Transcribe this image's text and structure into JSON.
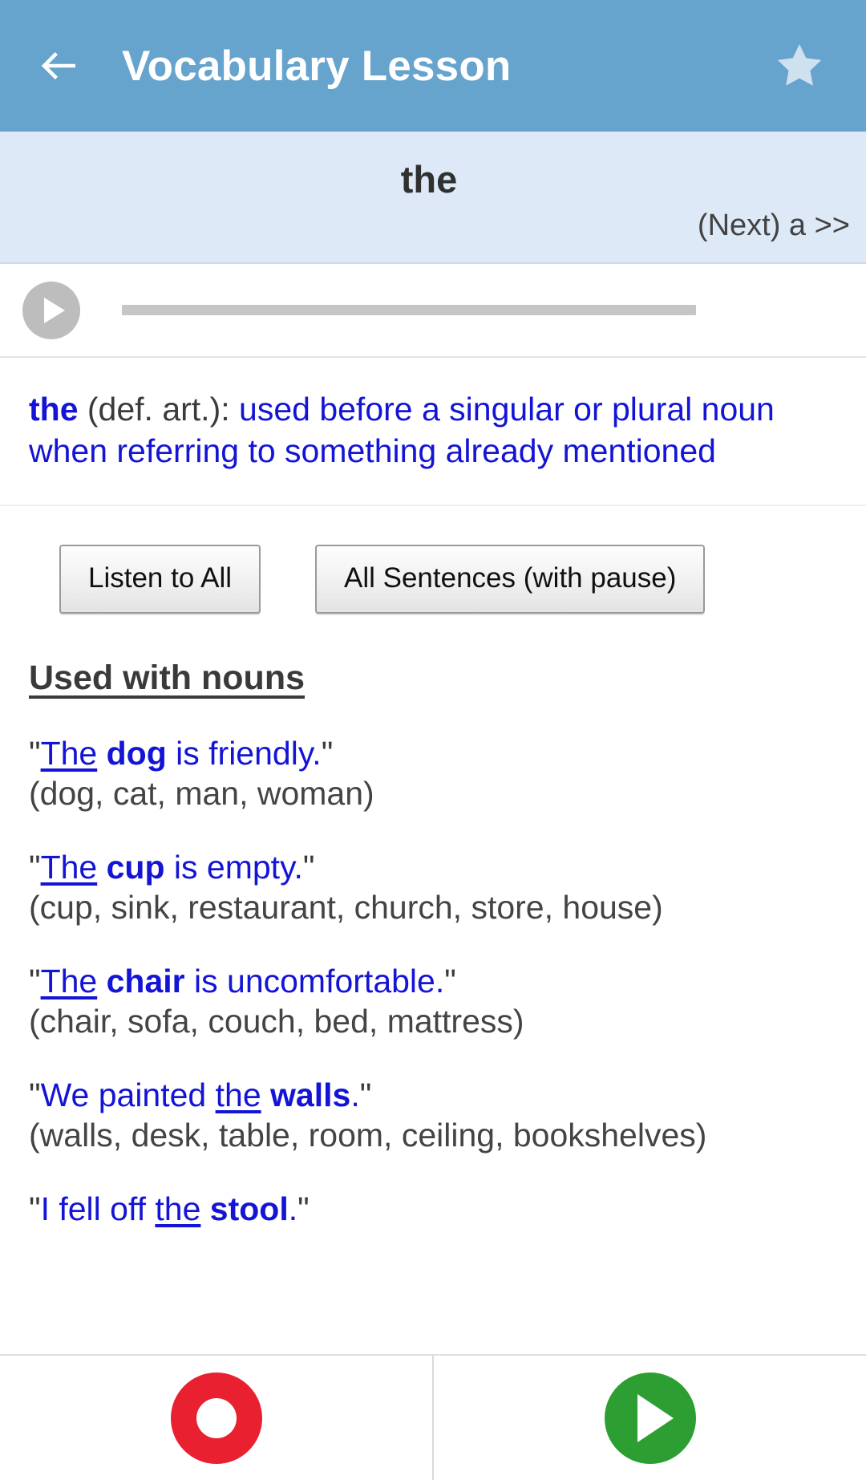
{
  "appbar": {
    "title": "Vocabulary Lesson",
    "back_icon": "back-arrow-icon",
    "star_icon": "star-icon",
    "background_color": "#66a3cd"
  },
  "word_strip": {
    "current_word": "the",
    "next_label": "(Next) a >>",
    "background_color": "#dde9f6"
  },
  "player": {
    "play_icon": "play-icon",
    "progress_percent": 0
  },
  "definition": {
    "headword": "the",
    "part_of_speech": "(def. art.):",
    "text": "used before a singular or plural noun when referring to something already mentioned",
    "color": "#1414d6"
  },
  "buttons": {
    "listen_all": "Listen to All",
    "all_sentences": "All Sentences (with pause)"
  },
  "section": {
    "title": "Used with nouns",
    "sentences": [
      {
        "open_quote": "\"",
        "parts": [
          {
            "text": "The",
            "underline": true,
            "bold": false
          },
          {
            "text": " ",
            "underline": false,
            "bold": false
          },
          {
            "text": "dog",
            "underline": false,
            "bold": true
          },
          {
            "text": " is friendly.",
            "underline": false,
            "bold": false
          }
        ],
        "close_quote": "\"",
        "plain": "\"The dog is friendly.\"",
        "variants": "(dog, cat, man, woman)"
      },
      {
        "open_quote": "\"",
        "parts": [
          {
            "text": "The",
            "underline": true,
            "bold": false
          },
          {
            "text": " ",
            "underline": false,
            "bold": false
          },
          {
            "text": "cup",
            "underline": false,
            "bold": true
          },
          {
            "text": " is empty.",
            "underline": false,
            "bold": false
          }
        ],
        "close_quote": "\"",
        "plain": "\"The cup is empty.\"",
        "variants": "(cup, sink, restaurant, church, store, house)"
      },
      {
        "open_quote": "\"",
        "parts": [
          {
            "text": "The",
            "underline": true,
            "bold": false
          },
          {
            "text": " ",
            "underline": false,
            "bold": false
          },
          {
            "text": "chair",
            "underline": false,
            "bold": true
          },
          {
            "text": " is uncomfortable.",
            "underline": false,
            "bold": false
          }
        ],
        "close_quote": "\"",
        "plain": "\"The chair is uncomfortable.\"",
        "variants": "(chair, sofa, couch, bed, mattress)"
      },
      {
        "open_quote": "\"",
        "parts": [
          {
            "text": "We painted ",
            "underline": false,
            "bold": false
          },
          {
            "text": "the",
            "underline": true,
            "bold": false
          },
          {
            "text": " ",
            "underline": false,
            "bold": false
          },
          {
            "text": "walls",
            "underline": false,
            "bold": true
          },
          {
            "text": ".",
            "underline": false,
            "bold": false
          }
        ],
        "close_quote": "\"",
        "plain": "\"We painted the walls.\"",
        "variants": "(walls, desk, table, room, ceiling, bookshelves)"
      },
      {
        "open_quote": "\"",
        "parts": [
          {
            "text": "I fell off ",
            "underline": false,
            "bold": false
          },
          {
            "text": "the",
            "underline": true,
            "bold": false
          },
          {
            "text": " ",
            "underline": false,
            "bold": false
          },
          {
            "text": "stool",
            "underline": false,
            "bold": true
          },
          {
            "text": ".",
            "underline": false,
            "bold": false
          }
        ],
        "close_quote": "\"",
        "plain": "\"I fell off the stool.\"",
        "variants": ""
      }
    ]
  },
  "recorder": {
    "record_icon": "record-icon",
    "play_icon": "play-icon",
    "record_color": "#e8202f",
    "play_color": "#2d9e31"
  }
}
